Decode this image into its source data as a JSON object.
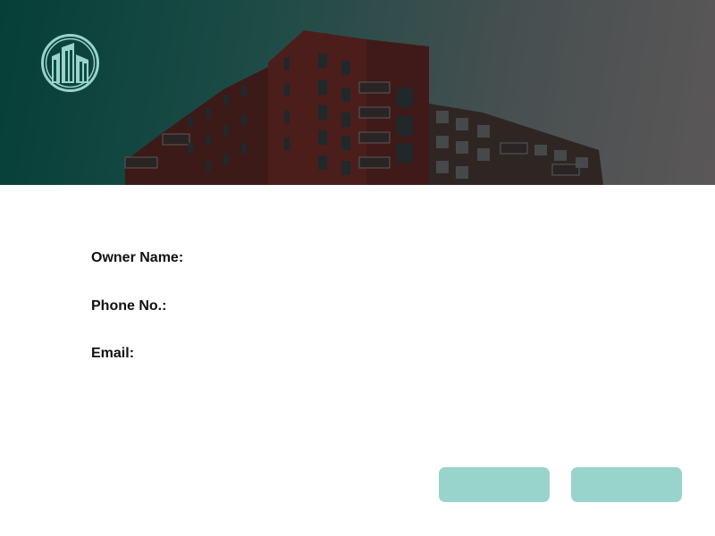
{
  "form": {
    "owner_name_label": "Owner Name:",
    "phone_label": "Phone No.:",
    "email_label": "Email:"
  },
  "buttons": {
    "left_label": "",
    "right_label": ""
  },
  "colors": {
    "accent": "#98d4cc",
    "hero_gradient_start": "#053f38",
    "hero_gradient_end": "#5b5758",
    "building_brick": "#4a1d1a"
  },
  "icons": {
    "logo": "city-buildings-icon"
  }
}
